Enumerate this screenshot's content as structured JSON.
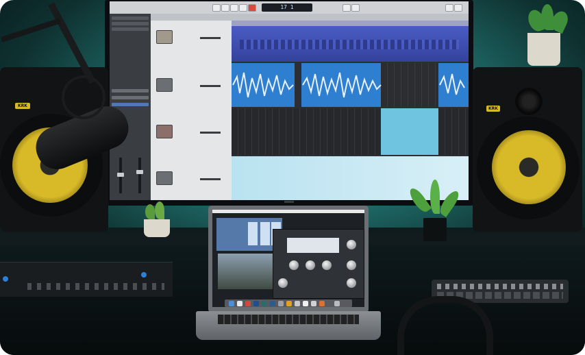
{
  "scene": {
    "description_tags": [
      "studio-desk",
      "monitor",
      "laptop",
      "speakers",
      "microphone",
      "plants"
    ]
  },
  "daw": {
    "lcd_text": "17 1",
    "tracks": [
      {
        "icon": "drum-machine-icon"
      },
      {
        "icon": "guitar-icon"
      },
      {
        "icon": "keyboard-icon"
      },
      {
        "icon": "amp-icon"
      }
    ]
  },
  "speakers": {
    "brand_left": "KRK",
    "brand_right": "KRK",
    "cone_color": "#d8b928"
  },
  "colors": {
    "backlight": "#3fb3ad",
    "region_blue": "#3d4fb0",
    "waveform_blue": "#2f7fd0",
    "region_light": "#6fc4e0"
  }
}
